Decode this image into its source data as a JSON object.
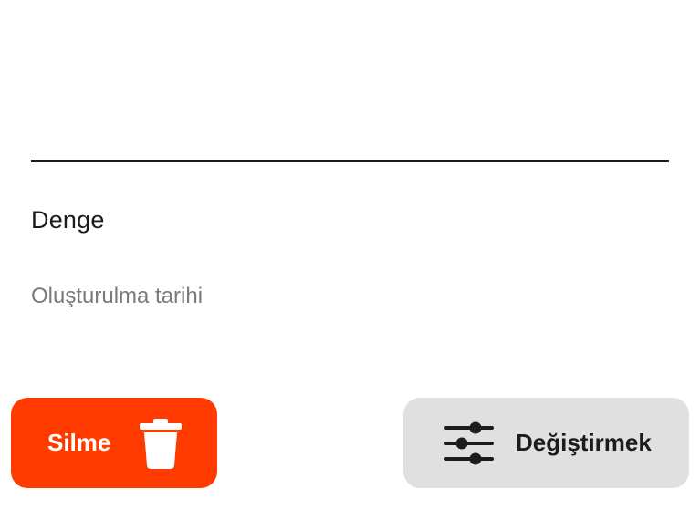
{
  "details": {
    "balance_label": "Denge",
    "created_label": "Oluşturulma tarihi"
  },
  "actions": {
    "delete_label": "Silme",
    "delete_icon": "trash-icon",
    "delete_color": "#ff3b00",
    "edit_label": "Değiştirmek",
    "edit_icon": "sliders-icon",
    "edit_color": "#e0e0e0"
  }
}
